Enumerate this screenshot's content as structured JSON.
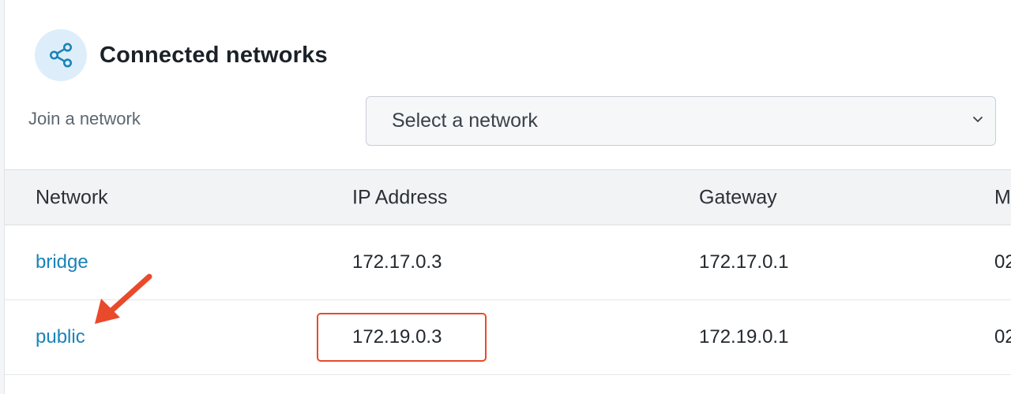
{
  "section": {
    "title": "Connected networks",
    "icon": "share-network-icon"
  },
  "join": {
    "label": "Join a network",
    "select_value": "Select a network"
  },
  "table": {
    "headers": [
      "Network",
      "IP Address",
      "Gateway",
      "M"
    ],
    "rows": [
      {
        "network": "bridge",
        "ip": "172.17.0.3",
        "gateway": "172.17.0.1",
        "mac": "02"
      },
      {
        "network": "public",
        "ip": "172.19.0.3",
        "gateway": "172.19.0.1",
        "mac": "02"
      }
    ]
  },
  "colors": {
    "link": "#1a83b8",
    "annotation": "#e94a2b",
    "icon_bg": "#ddeefa",
    "icon_fg": "#1a83b8"
  }
}
